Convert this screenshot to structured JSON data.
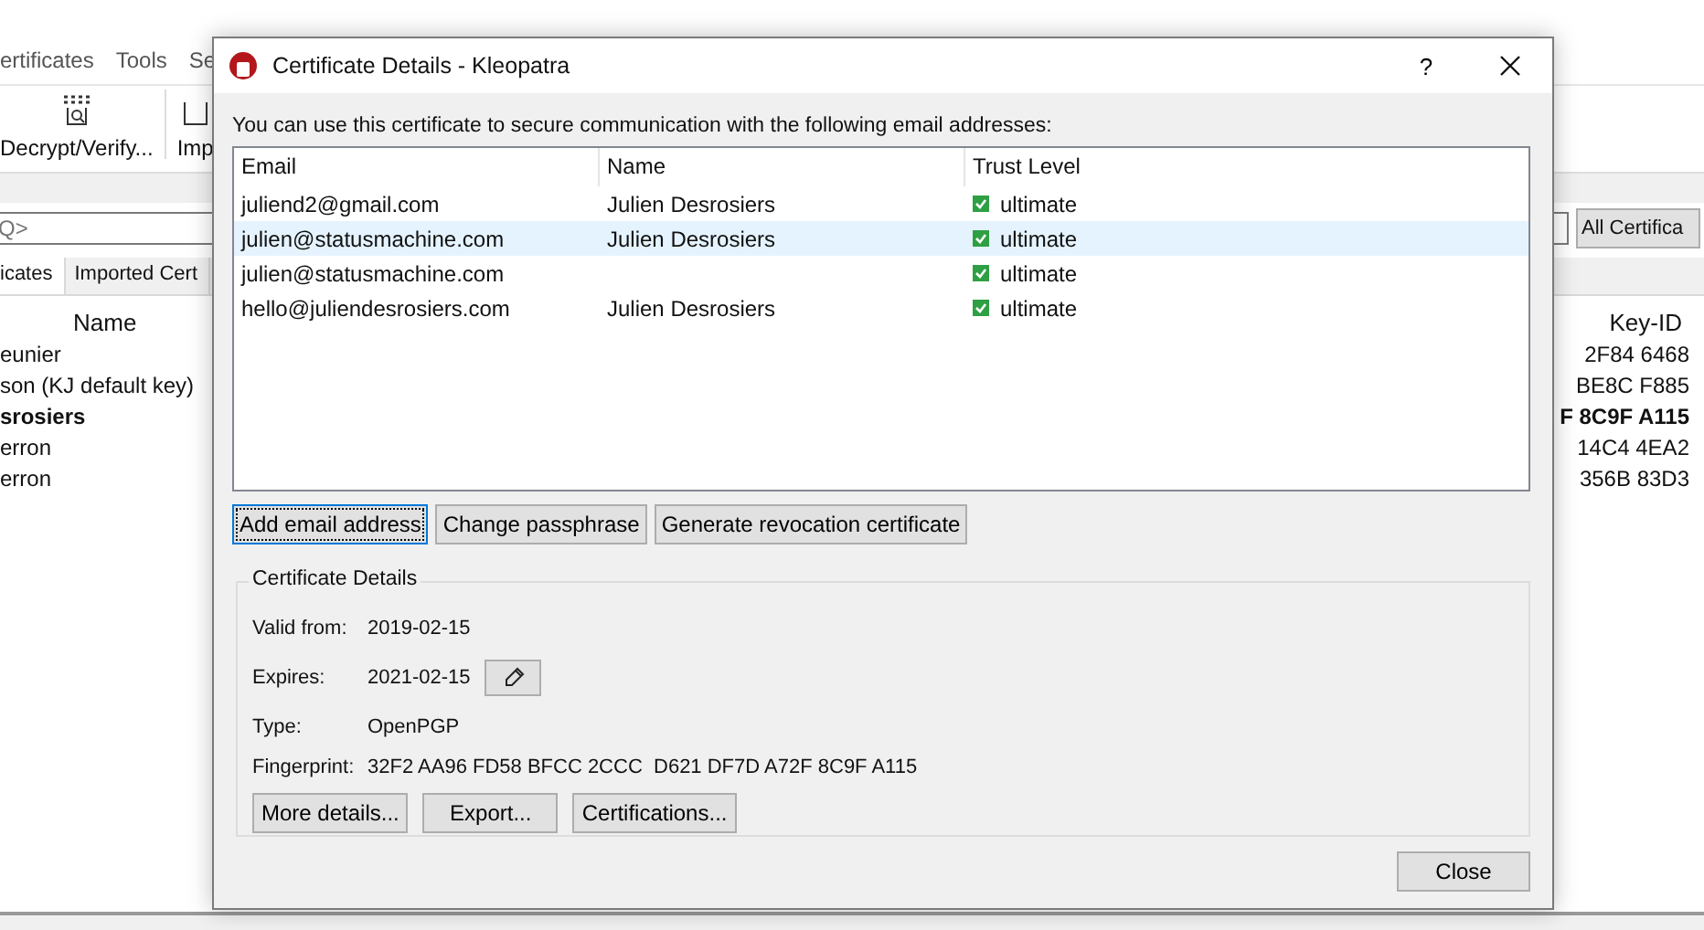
{
  "main_window": {
    "menu": [
      {
        "label": "ertificates"
      },
      {
        "label": "Tools"
      },
      {
        "label": "Se"
      }
    ],
    "toolbar": [
      {
        "label": "Decrypt/Verify..."
      },
      {
        "label": "Imp"
      }
    ],
    "search": {
      "placeholder": "Q>"
    },
    "filter": {
      "value": "All Certifica"
    },
    "tabs": [
      {
        "label": "icates",
        "selected": true
      },
      {
        "label": "Imported Cert",
        "selected": false
      }
    ],
    "columns": [
      "Name",
      "Key-ID"
    ],
    "rows": [
      {
        "name": "eunier",
        "key_id": "2F84 6468",
        "bold": false
      },
      {
        "name": "son (KJ default key)",
        "key_id": "BE8C F885",
        "bold": false
      },
      {
        "name": "srosiers",
        "key_id": "F 8C9F A115",
        "bold": true
      },
      {
        "name": "erron",
        "key_id": "14C4 4EA2",
        "bold": false
      },
      {
        "name": "erron",
        "key_id": "356B 83D3",
        "bold": false
      }
    ]
  },
  "dialog": {
    "title": "Certificate Details - Kleopatra",
    "help": "?",
    "intro": "You can use this certificate to secure communication with the following email addresses:",
    "table": {
      "columns": [
        "Email",
        "Name",
        "Trust Level"
      ],
      "rows": [
        {
          "email": "juliend2@gmail.com",
          "name": "Julien Desrosiers",
          "trust": "ultimate",
          "selected": false
        },
        {
          "email": "julien@statusmachine.com",
          "name": "Julien Desrosiers",
          "trust": "ultimate",
          "selected": true
        },
        {
          "email": "julien@statusmachine.com",
          "trust": "ultimate",
          "selected": false
        },
        {
          "email": "hello@juliendesrosiers.com",
          "name": "Julien Desrosiers",
          "trust": "ultimate",
          "selected": false
        }
      ]
    },
    "actions": [
      {
        "label": "Add email address",
        "focused": true
      },
      {
        "label": "Change passphrase",
        "focused": false
      },
      {
        "label": "Generate revocation certificate",
        "focused": false
      }
    ],
    "details": {
      "title": "Certificate Details",
      "fields": [
        {
          "label": "Valid from:",
          "value": "2019-02-15",
          "kind": "text"
        },
        {
          "label": "Expires:",
          "value": "2021-02-15",
          "kind": "editable"
        },
        {
          "label": "Type:",
          "value": "OpenPGP",
          "kind": "text"
        },
        {
          "label": "Fingerprint:",
          "value": "32F2 AA96 FD58 BFCC 2CCC  D621 DF7D A72F 8C9F A115",
          "kind": "text"
        }
      ],
      "buttons": [
        "More details...",
        "Export...",
        "Certifications..."
      ]
    },
    "close_button": "Close"
  }
}
